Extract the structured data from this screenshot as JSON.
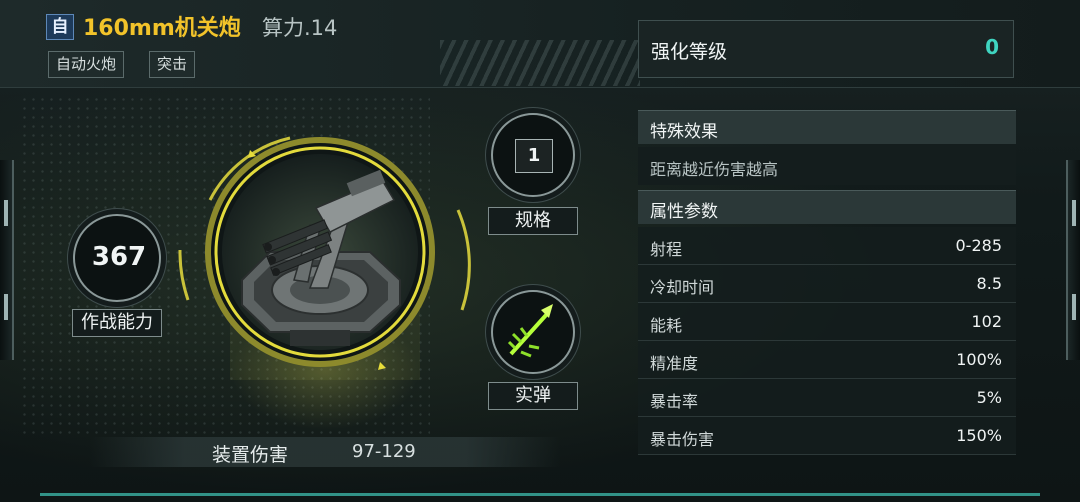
{
  "header": {
    "badge": "自",
    "title": "160mm机关炮",
    "power": "算力.14",
    "tags": [
      "自动火炮",
      "突击"
    ]
  },
  "left": {
    "combat_value": "367",
    "combat_label": "作战能力",
    "spec_value": "1",
    "spec_label": "规格",
    "ammo_label": "实弹",
    "damage_label": "装置伤害",
    "damage_value": "97-129"
  },
  "right": {
    "level_label": "强化等级",
    "level_value": "0",
    "special_title": "特殊效果",
    "special_effect": "距离越近伤害越高",
    "params_title": "属性参数",
    "params": [
      {
        "name": "射程",
        "value": "0-285"
      },
      {
        "name": "冷却时间",
        "value": "8.5"
      },
      {
        "name": "能耗",
        "value": "102"
      },
      {
        "name": "精准度",
        "value": "100%"
      },
      {
        "name": "暴击率",
        "value": "5%"
      },
      {
        "name": "暴击伤害",
        "value": "150%"
      }
    ]
  },
  "colors": {
    "title": "#f2c32a",
    "accent_teal": "#3fd4c0",
    "ring_yellow": "#d9d23a"
  },
  "icons": [
    "turret-image",
    "ammo-icon"
  ]
}
